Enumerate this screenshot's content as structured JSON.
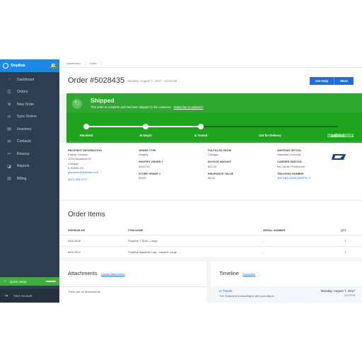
{
  "sidebar": {
    "brand": "ShipBob",
    "items": [
      {
        "label": "Dashboard",
        "icon": "dashboard-icon",
        "glyph": "◔"
      },
      {
        "label": "Orders",
        "icon": "orders-icon",
        "glyph": "☰"
      },
      {
        "label": "New Order",
        "icon": "plus-icon",
        "glyph": "⊕"
      },
      {
        "label": "Sync Orders",
        "icon": "sync-icon",
        "glyph": "⟳"
      },
      {
        "label": "Inventory",
        "icon": "inventory-icon",
        "glyph": "▤"
      },
      {
        "label": "Contacts",
        "icon": "contacts-icon",
        "glyph": "✉"
      },
      {
        "label": "Returns",
        "icon": "returns-icon",
        "glyph": "↩"
      },
      {
        "label": "Reports",
        "icon": "reports-icon",
        "glyph": "◪"
      },
      {
        "label": "Billing",
        "icon": "billing-icon",
        "glyph": "▥"
      }
    ],
    "quick_setup": "Quick setup",
    "account": "Your Account"
  },
  "breadcrumb": [
    "Dashboard",
    "Order"
  ],
  "header": {
    "order_title": "Order #5028435",
    "order_date": "Monday, August 7, 2017 - 10:04AM",
    "help_button": "Get Help",
    "more_button": "More"
  },
  "status": {
    "title": "Shipped",
    "message": "This order is complete and has been shipped to the customer.",
    "subscribe_link": "Subscribe to updates?",
    "stages": [
      "Received",
      "At Depot",
      "In Transit",
      "Out for Delivery",
      "Delivered"
    ],
    "completed_stages": 3,
    "usps_link": "See USPS Tracking",
    "colors": {
      "banner": "#2ea82e",
      "band": "#1fa41f",
      "done_line": "#ffffff",
      "pending_line": "#166b16"
    }
  },
  "details": {
    "recipient": {
      "label": "RECIPIENT INFORMATION",
      "name": "Patrick Johnson",
      "street": "1234 Rokasinet St",
      "city": "Chicago",
      "state_zip": "IL 60606 US",
      "email": "pjohnson@shipbob.com",
      "phone": "(847) 508-3717"
    },
    "order_type_label": "ORDER TYPE",
    "order_type": "Shopify",
    "shopify_order_label": "SHOPIFY ORDER #",
    "shopify_order": "5202719",
    "store_order_label": "STORE ORDER #",
    "store_order": "00001",
    "fulfilled_label": "FULFILLED FROM",
    "fulfilled": "Chicago",
    "invoice_label": "INVOICE AMOUNT",
    "invoice": "$15.25",
    "insurance_label": "INSURANCE VALUE",
    "insurance": "$0.00",
    "shipping_label": "SHIPPING OPTION",
    "shipping": "Standard (Ground)",
    "carrier_label": "CARRIER SERVICE",
    "carrier": "No Carrier Preference",
    "tracking_label": "TRACKING NUMBER",
    "tracking": "1DFGB1LN34EGB9P94"
  },
  "items": {
    "title": "Order Items",
    "headers": [
      "SHIPBOB #ID",
      "ITEM NAME",
      "SERIAL NUMBER",
      "QTY"
    ],
    "rows": [
      [
        "#8214928",
        "ShipBob T-Shirt - Large",
        "-",
        "1"
      ],
      [
        "#8214942",
        "ShipBob Baseball Cap - Large/X-Large",
        "-",
        "1"
      ]
    ]
  },
  "attachments": {
    "title": "Attachments",
    "upload_link": "Upload Attachment",
    "empty": "There are no attachments"
  },
  "timeline": {
    "title": "Timeline",
    "subscribe_link": "Subscribe",
    "entries": [
      {
        "status": "In Transit",
        "date": "Monday, August 7, 2017",
        "time": "04:07PM",
        "message": "The Shipment is traveling to the local depot."
      }
    ]
  }
}
